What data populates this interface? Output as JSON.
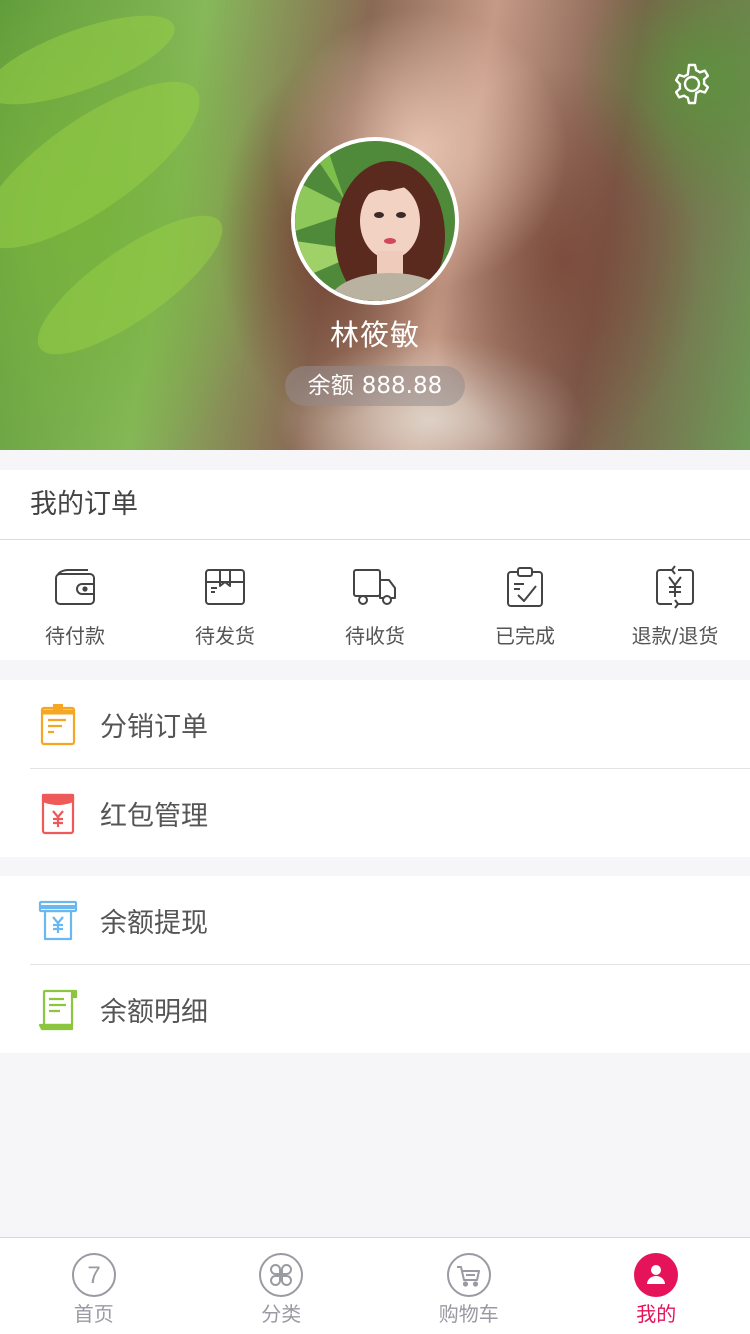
{
  "profile": {
    "name": "林筱敏",
    "balance_label": "余额",
    "balance_value": "888.88"
  },
  "orders": {
    "title": "我的订单",
    "items": [
      {
        "label": "待付款",
        "icon": "wallet-icon"
      },
      {
        "label": "待发货",
        "icon": "package-icon"
      },
      {
        "label": "待收货",
        "icon": "truck-icon"
      },
      {
        "label": "已完成",
        "icon": "clipboard-check-icon"
      },
      {
        "label": "退款/退货",
        "icon": "refund-icon"
      }
    ]
  },
  "menu": {
    "group1": [
      {
        "label": "分销订单",
        "icon": "distribution-order-icon",
        "color": "#f5a623"
      },
      {
        "label": "红包管理",
        "icon": "red-packet-icon",
        "color": "#ee5a5a"
      }
    ],
    "group2": [
      {
        "label": "余额提现",
        "icon": "withdraw-icon",
        "color": "#6bb7f0"
      },
      {
        "label": "余额明细",
        "icon": "balance-detail-icon",
        "color": "#8cc63f"
      }
    ]
  },
  "tabbar": {
    "items": [
      {
        "label": "首页",
        "icon": "home-icon",
        "glyph": "7"
      },
      {
        "label": "分类",
        "icon": "category-icon"
      },
      {
        "label": "购物车",
        "icon": "cart-icon"
      },
      {
        "label": "我的",
        "icon": "profile-icon",
        "active": true
      }
    ]
  },
  "colors": {
    "accent": "#e5145a",
    "page_bg": "#f6f6f9",
    "text_muted": "#9a9aa2"
  }
}
